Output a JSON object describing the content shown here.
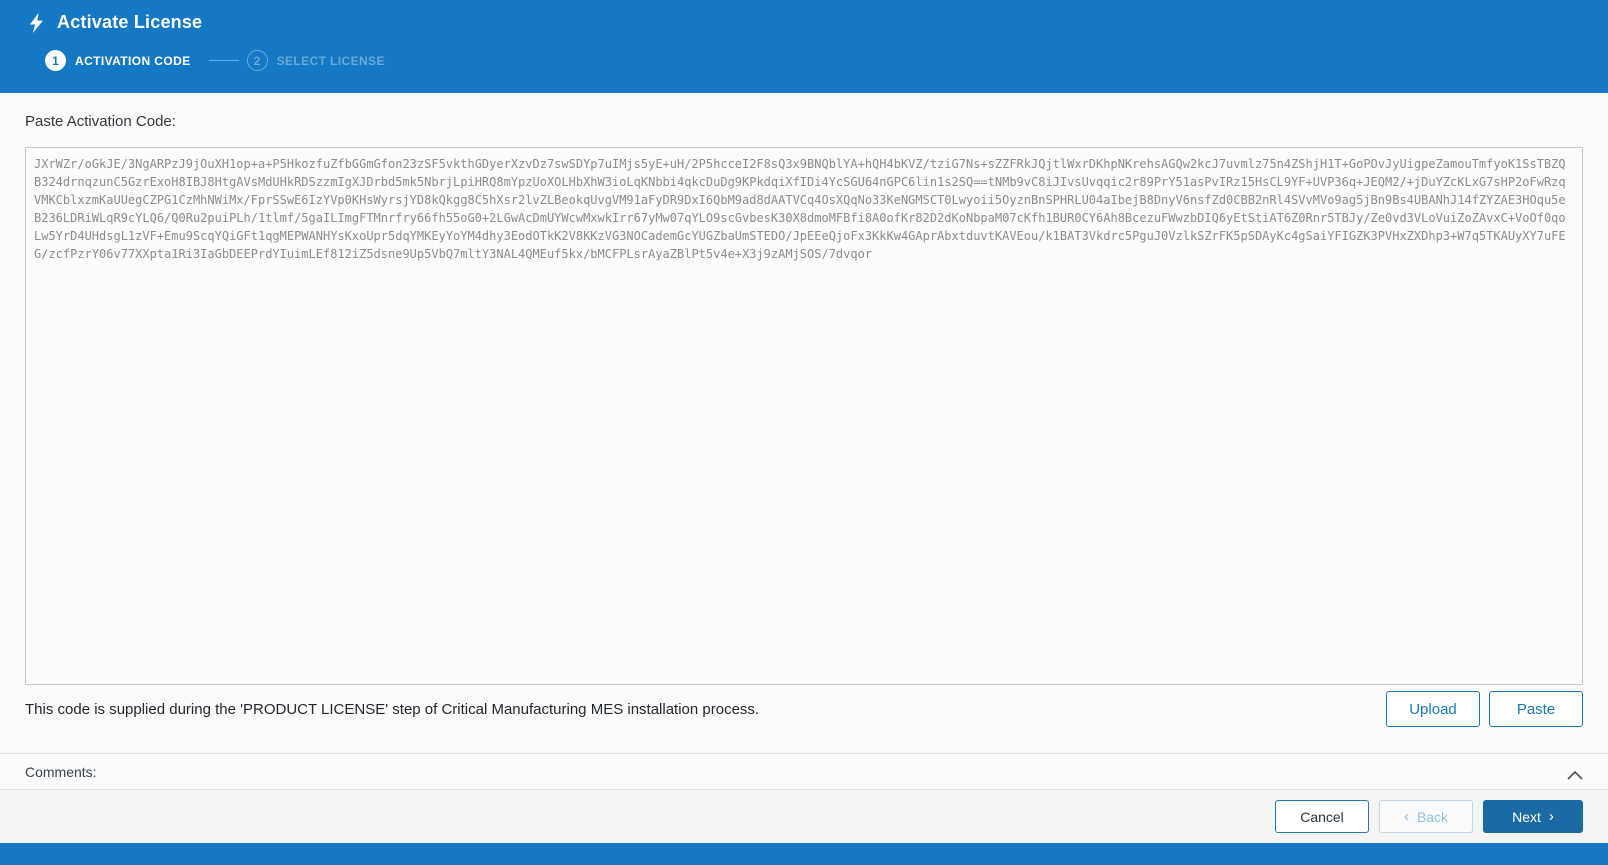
{
  "header": {
    "title": "Activate License",
    "steps": [
      {
        "number": "1",
        "label": "ACTIVATION CODE"
      },
      {
        "number": "2",
        "label": "SELECT LICENSE"
      }
    ]
  },
  "form": {
    "label": "Paste Activation Code:",
    "activation_code": "JXrWZr/oGkJE/3NgARPzJ9jOuXH1op+a+P5HkozfuZfbGGmGfon23zSF5vkthGDyerXzvDz7swSDYp7uIMjs5yE+uH/2P5hcceI2F8sQ3x9BNQblYA+hQH4bKVZ/tziG7Ns+sZZFRkJQjtlWxrDKhpNKrehsAGQw2kcJ7uvmlz75n4ZShjH1T+GoPOvJyUigpeZamouTmfyoK1SsTBZQ\nB324drnqzunC5GzrExoH8IBJ8HtgAVsMdUHkRDSzzmIgXJDrbd5mk5NbrjLpiHRQ8mYpzUoXOLHbXhW3ioLqKNbbi4qkcDuDg9KPkdqiXfIDi4YcSGU64nGPC6lin1s2SQ==tNMb9vC8iJIvsUvqqic2r89PrY51asPvIRz15HsCL9YF+UVP36q+JEQM2/+jDuYZcKLxG7sHP2oFwRzq\nVMKCblxzmKaUUegCZPG1CzMhNWiMx/FprSSwE6IzYVp0KHsWyrsjYD8kQkgg8C5hXsr2lvZLBeokqUvgVM91aFyDR9DxI6QbM9ad8dAATVCq4OsXQqNo33KeNGMSCT0Lwyoii5OyznBnSPHRLU04aIbejB8DnyV6nsfZd0CBB2nRl4SVvMVo9ag5jBn9Bs4UBANhJ14fZYZAE3HOqu5e\nB236LDRiWLqR9cYLQ6/Q0Ru2puiPLh/1tlmf/5gaILImgFTMnrfry66fh55oG0+2LGwAcDmUYWcwMxwkIrr67yMw07qYLO9scGvbesK30X8dmoMFBfi8A0ofKr82D2dKoNbpaM07cKfh1BUR0CY6Ah8BcezuFWwzbDIQ6yEtStiAT6Z0Rnr5TBJy/Ze0vd3VLoVuiZoZAvxC+VoOf0qo\nLw5YrD4UHdsgL1zVF+Emu9ScqYQiGFt1qgMEPWANHYsKxoUpr5dqYMKEyYoYM4dhy3EodOTkK2V8KKzVG3NOCademGcYUGZbaUmSTEDO/JpEEeQjoFx3KkKw4GAprAbxtduvtKAVEou/k1BAT3Vkdrc5PguJ0VzlkSZrFK5pSDAyKc4gSaiYFIGZK3PVHxZXDhp3+W7q5TKAUyXY7uFE\nG/zcfPzrY06v77XXpta1Ri3IaGbDEEPrdYIuimLEf812iZ5dsne9Up5VbQ7mltY3NAL4QMEuf5kx/bMCFPLsrAyaZBlPt5v4e+X3j9zAMjSOS/7dvqor",
    "helper_text": "This code is supplied during the 'PRODUCT LICENSE' step of Critical Manufacturing MES installation process.",
    "upload_label": "Upload",
    "paste_label": "Paste"
  },
  "comments": {
    "label": "Comments:"
  },
  "footer": {
    "cancel_label": "Cancel",
    "back_chevron": "‹",
    "back_label": "Back",
    "next_label": "Next",
    "next_chevron": "›"
  },
  "colors": {
    "header_blue": "#1478c4",
    "accent_blue": "#1878b8",
    "next_button_blue": "#1a6ba3",
    "inactive_step_blue": "#68aad7",
    "disabled_blue": "#bcd8ea",
    "code_text_gray": "#8c8c8c"
  }
}
